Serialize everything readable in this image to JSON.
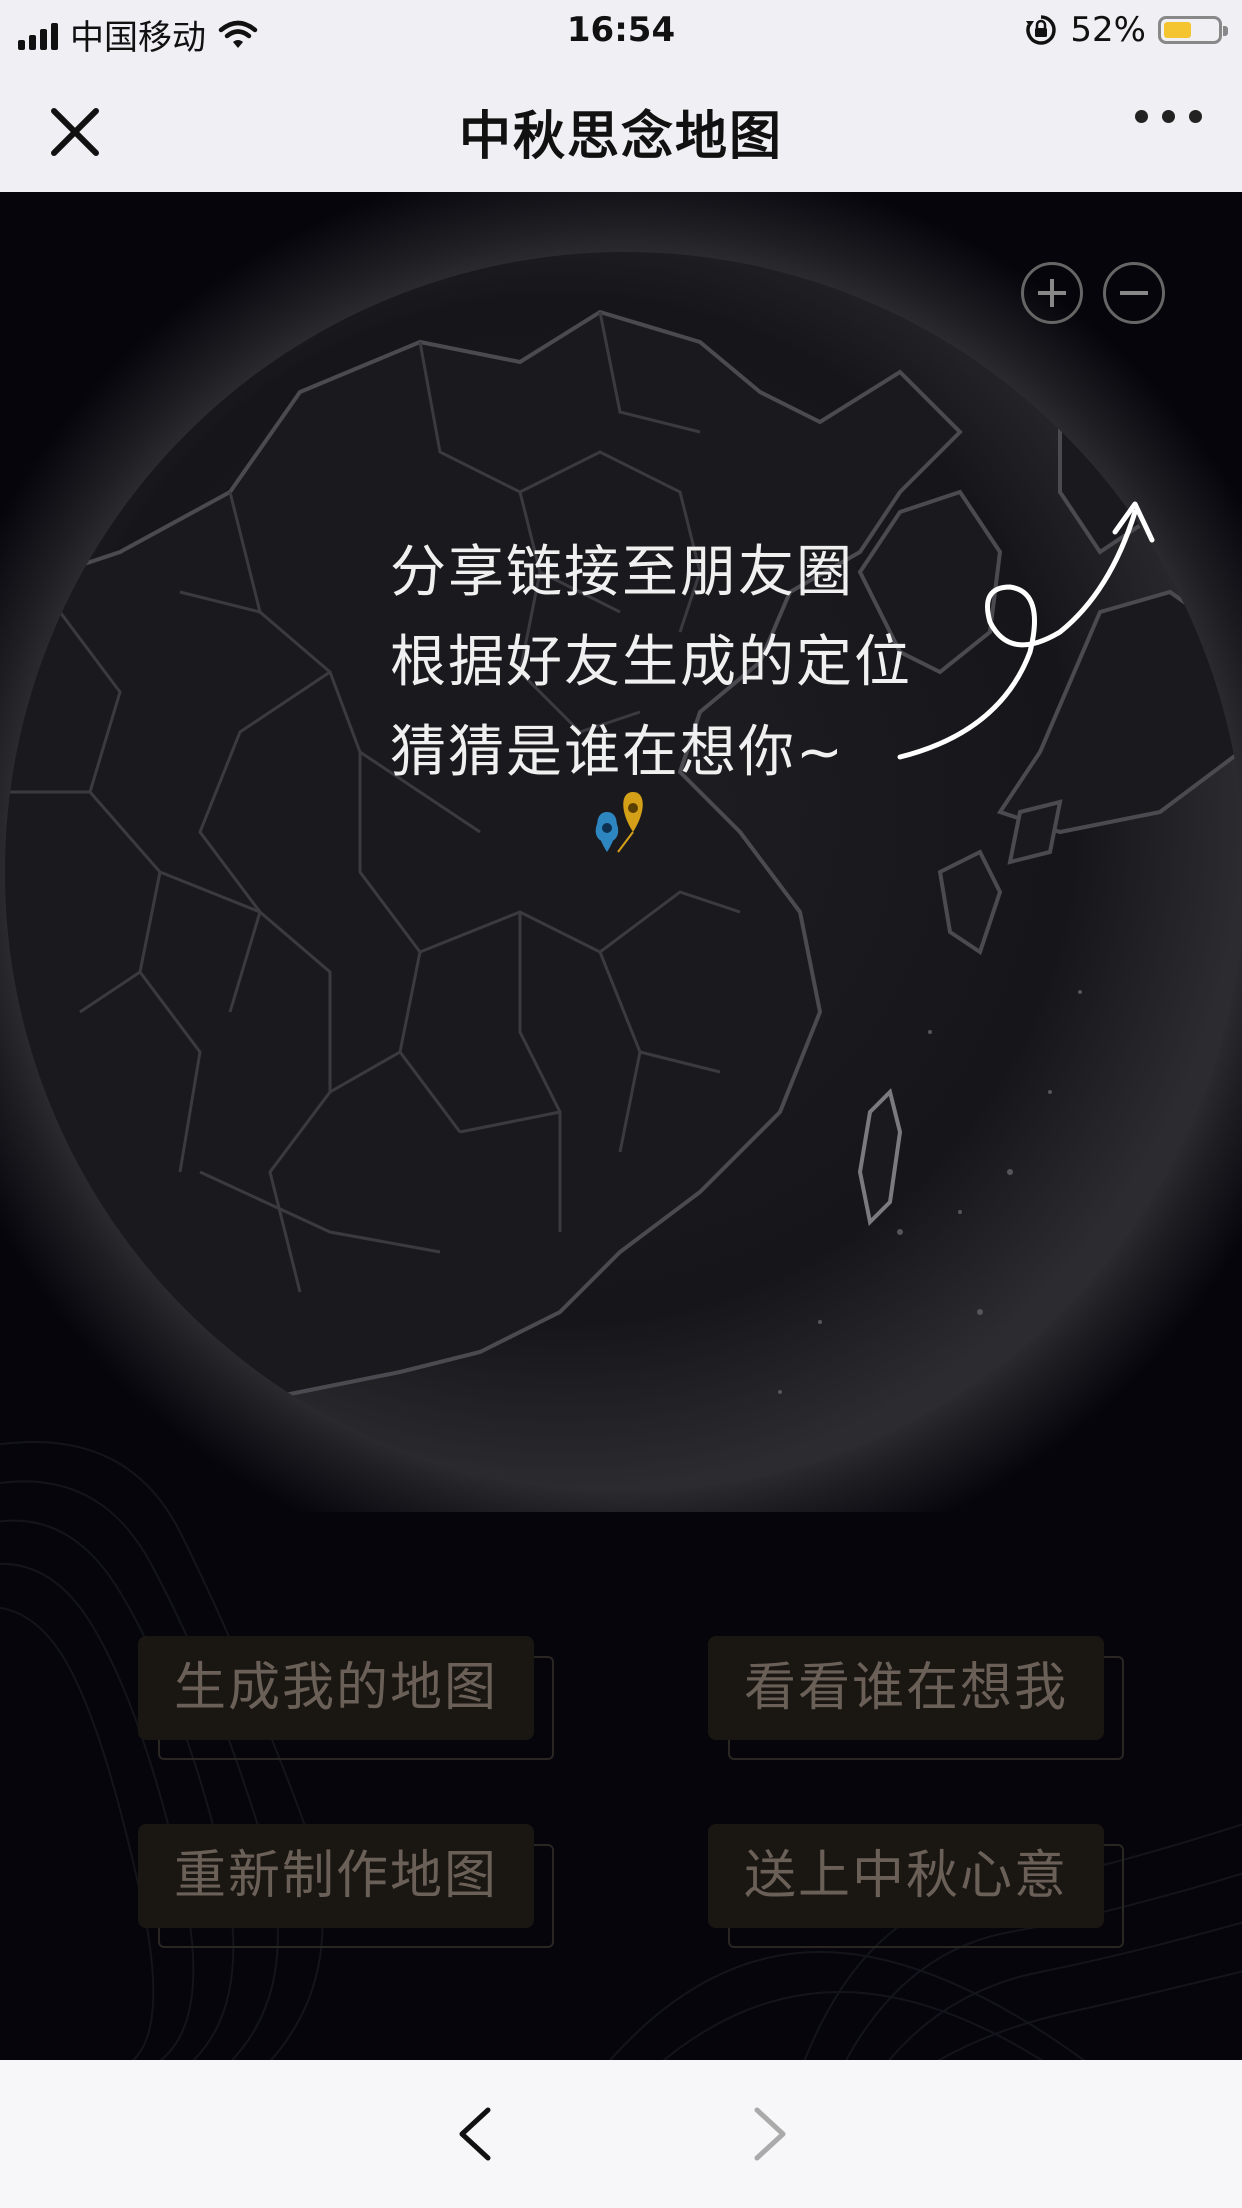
{
  "status_bar": {
    "carrier": "中国移动",
    "time": "16:54",
    "battery_percent": "52%",
    "battery_level": 0.52,
    "icons": [
      "signal-icon",
      "wifi-icon",
      "rotation-lock-icon",
      "battery-icon"
    ]
  },
  "title_bar": {
    "title": "中秋思念地图",
    "close_icon": "close-icon",
    "more_icon": "more-icon"
  },
  "map": {
    "zoom_in_icon": "plus-icon",
    "zoom_out_icon": "minus-icon",
    "hint_lines": [
      "分享链接至朋友圈",
      "根据好友生成的定位",
      "猜猜是谁在想你~"
    ],
    "pins": [
      {
        "color": "#2e86c1",
        "name": "blue-pin"
      },
      {
        "color": "#d4a017",
        "name": "yellow-pin"
      }
    ]
  },
  "buttons": {
    "generate_map": "生成我的地图",
    "who_misses_me": "看看谁在想我",
    "remake_map": "重新制作地图",
    "send_wishes": "送上中秋心意"
  },
  "bottom_nav": {
    "back_icon": "chevron-left-icon",
    "forward_icon": "chevron-right-icon"
  },
  "colors": {
    "background": "#05050b",
    "button_face": "#1a1612",
    "button_text": "#6a6058",
    "hint_text": "#f0f0f0"
  }
}
